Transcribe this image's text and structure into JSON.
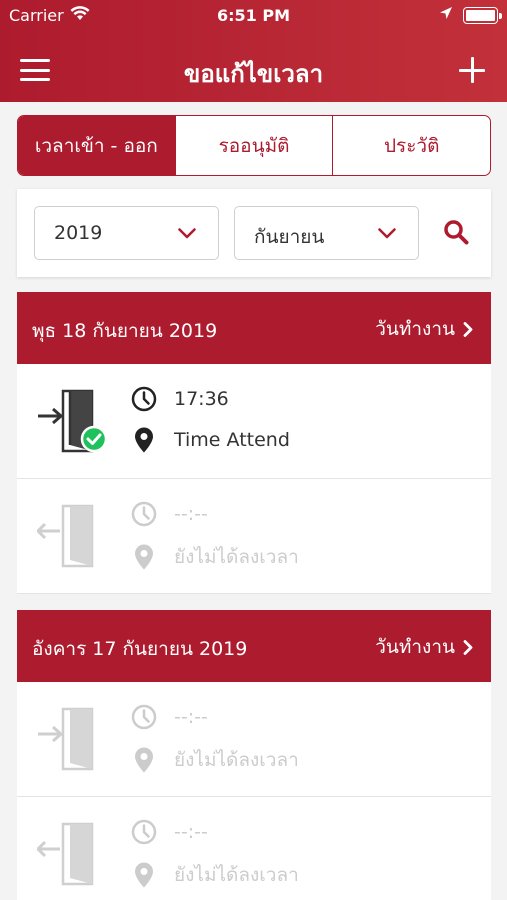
{
  "status_bar": {
    "carrier": "Carrier",
    "time": "6:51 PM"
  },
  "nav": {
    "title": "ขอแก้ไขเวลา",
    "menu_icon": "hamburger-icon",
    "add_icon": "plus-icon"
  },
  "tabs": [
    {
      "label": "เวลาเข้า - ออก",
      "active": true
    },
    {
      "label": "รออนุมัติ",
      "active": false
    },
    {
      "label": "ประวัติ",
      "active": false
    }
  ],
  "filter": {
    "year": "2019",
    "month": "กันยายน"
  },
  "days": [
    {
      "date": "พุธ 18 กันยายน 2019",
      "status": "วันทำงาน",
      "entries": [
        {
          "time": "17:36",
          "location": "Time Attend",
          "recorded": true
        },
        {
          "time": "--:--",
          "location": "ยังไม่ได้ลงเวลา",
          "recorded": false
        }
      ]
    },
    {
      "date": "อังคาร 17 กันยายน 2019",
      "status": "วันทำงาน",
      "entries": [
        {
          "time": "--:--",
          "location": "ยังไม่ได้ลงเวลา",
          "recorded": false
        },
        {
          "time": "--:--",
          "location": "ยังไม่ได้ลงเวลา",
          "recorded": false
        }
      ]
    }
  ],
  "colors": {
    "brand": "#ad1b2e",
    "check": "#1ec15b",
    "muted": "#cccccc"
  }
}
